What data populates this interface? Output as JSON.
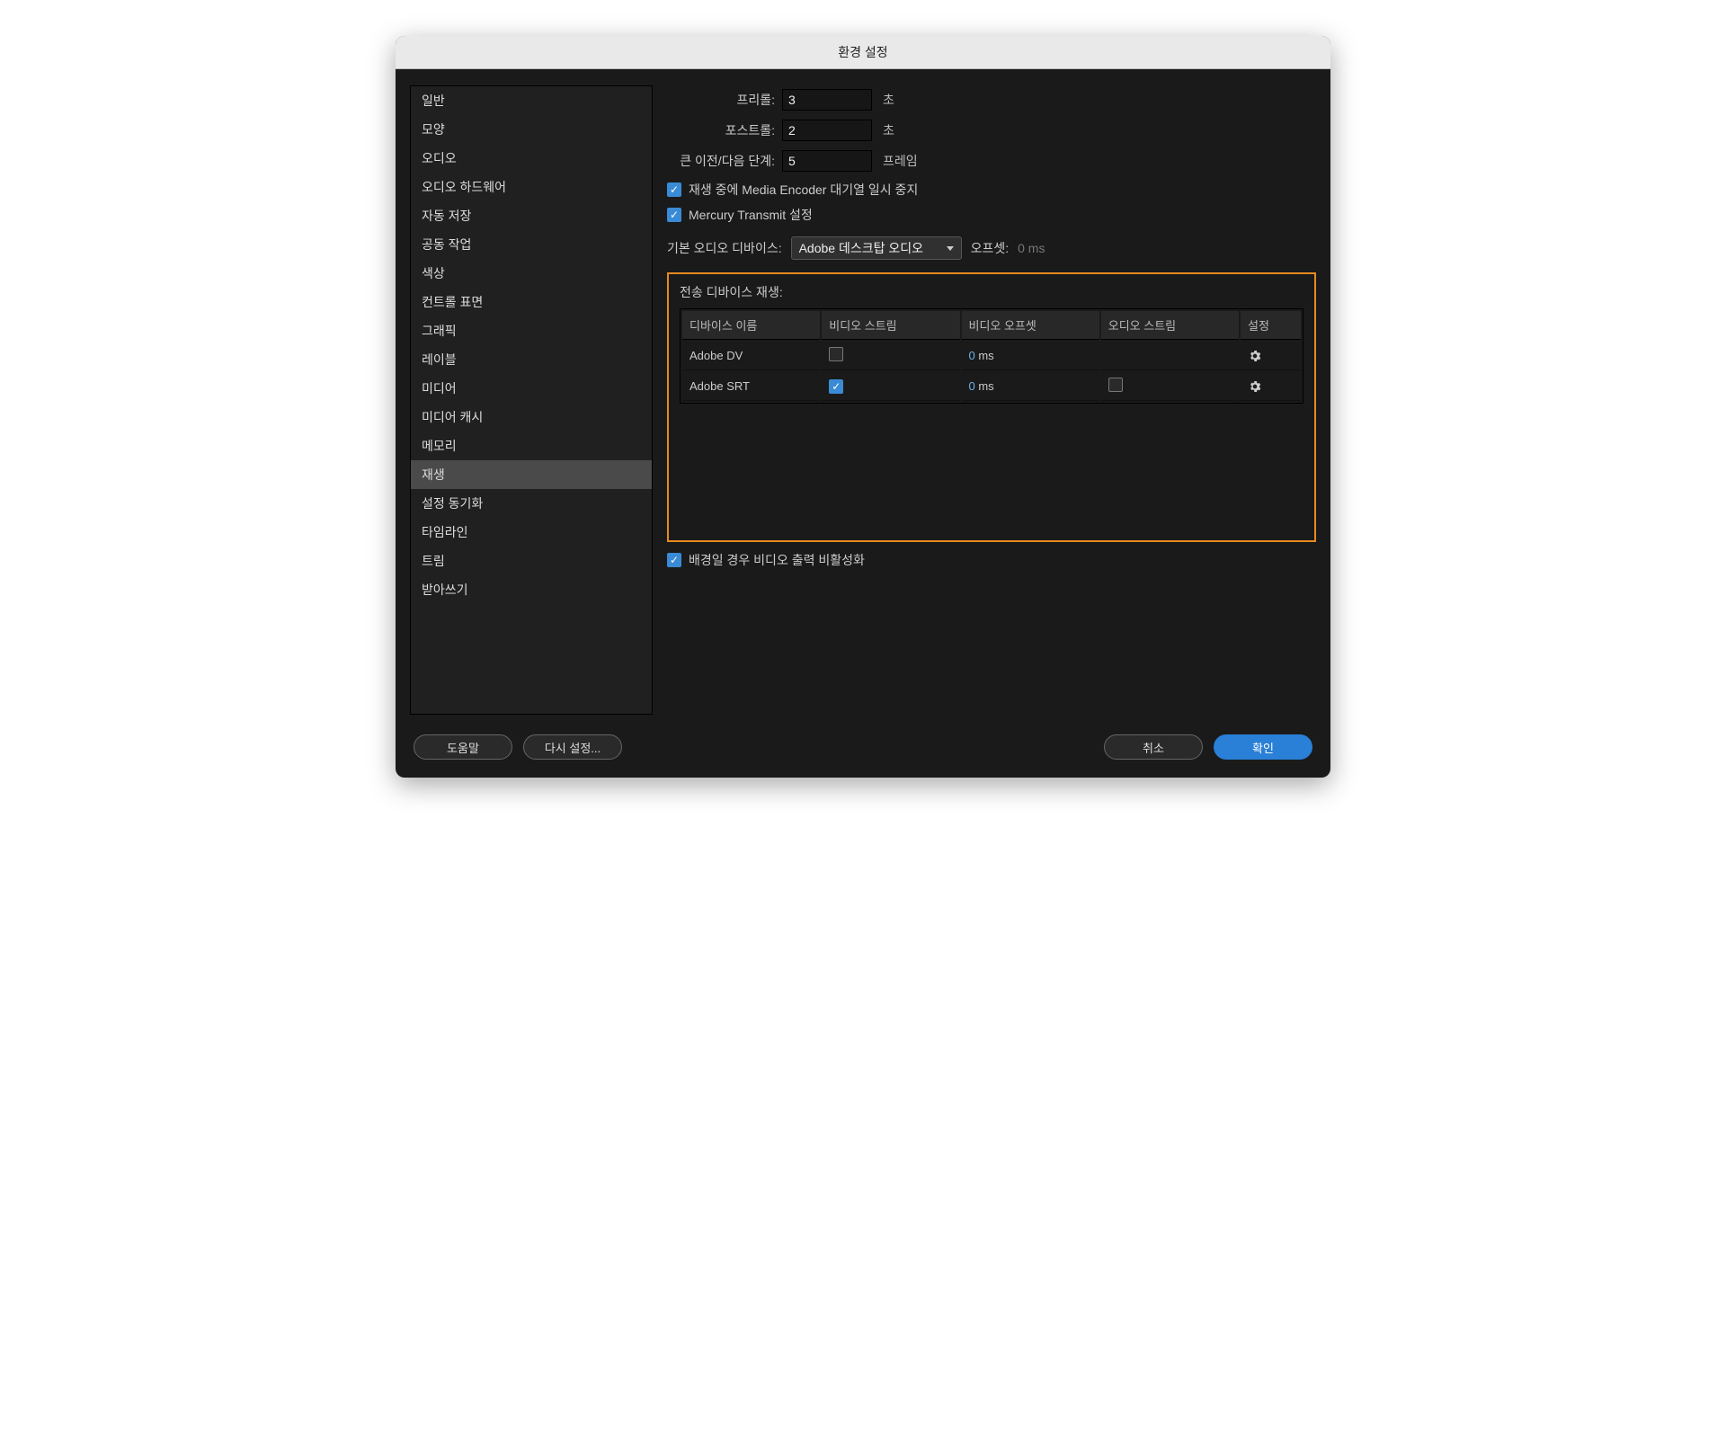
{
  "window": {
    "title": "환경 설정"
  },
  "sidebar": {
    "items": [
      "일반",
      "모양",
      "오디오",
      "오디오 하드웨어",
      "자동 저장",
      "공동 작업",
      "색상",
      "컨트롤 표면",
      "그래픽",
      "레이블",
      "미디어",
      "미디어 캐시",
      "메모리",
      "재생",
      "설정 동기화",
      "타임라인",
      "트림",
      "받아쓰기"
    ],
    "selected_index": 13
  },
  "form": {
    "preroll_label": "프리롤:",
    "preroll_value": "3",
    "postroll_label": "포스트롤:",
    "postroll_value": "2",
    "seconds_unit": "초",
    "step_label": "큰 이전/다음 단계:",
    "step_value": "5",
    "frames_unit": "프레임"
  },
  "checks": {
    "pause_encoder": "재생 중에 Media Encoder 대기열 일시 중지",
    "mercury": "Mercury Transmit 설정",
    "disable_bg": "배경일 경우 비디오 출력 비활성화"
  },
  "audio": {
    "default_device_label": "기본 오디오 디바이스:",
    "default_device_value": "Adobe 데스크탑 오디오",
    "offset_label": "오프셋:",
    "offset_value": "0 ms"
  },
  "device_table": {
    "title": "전송 디바이스 재생:",
    "headers": [
      "디바이스 이름",
      "비디오 스트림",
      "비디오 오프셋",
      "오디오 스트림",
      "설정"
    ],
    "rows": [
      {
        "name": "Adobe DV",
        "video_stream": false,
        "video_offset_num": "0",
        "video_offset_unit": " ms",
        "audio_stream": null,
        "settings": true
      },
      {
        "name": "Adobe SRT",
        "video_stream": true,
        "video_offset_num": "0",
        "video_offset_unit": " ms",
        "audio_stream": false,
        "settings": true
      }
    ]
  },
  "buttons": {
    "help": "도움말",
    "reset": "다시 설정...",
    "cancel": "취소",
    "ok": "확인"
  }
}
